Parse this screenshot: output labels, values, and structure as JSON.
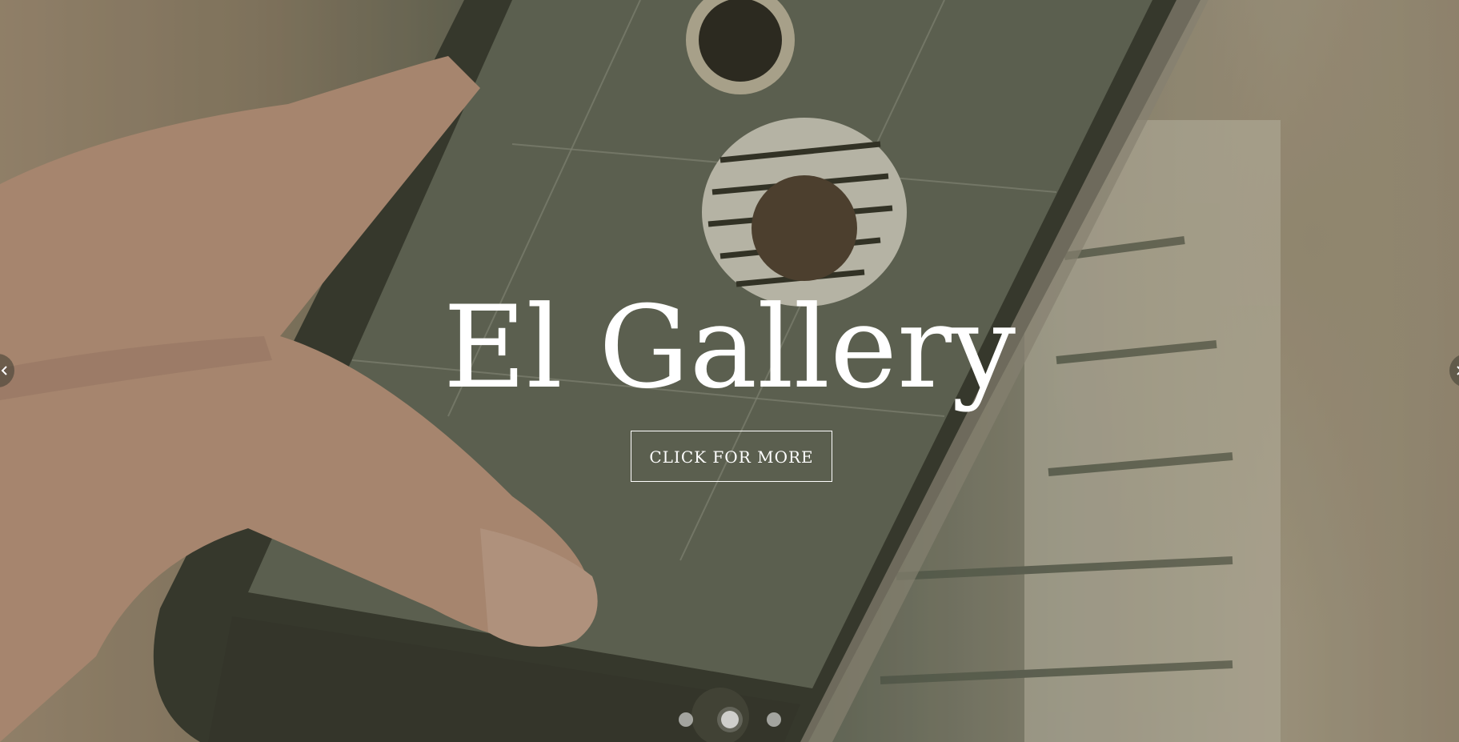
{
  "hero": {
    "title": "El Gallery",
    "cta_label": "CLICK FOR MORE",
    "background_image": "hand-holding-phone-photographing-coffee-and-cookie"
  },
  "slider": {
    "prev_icon": "chevron-left-icon",
    "next_icon": "chevron-right-icon",
    "dot_count": 3,
    "active_index": 1
  },
  "colors": {
    "text": "#ffffff",
    "overlay": "#3c3c28",
    "button_border": "#ffffff"
  }
}
